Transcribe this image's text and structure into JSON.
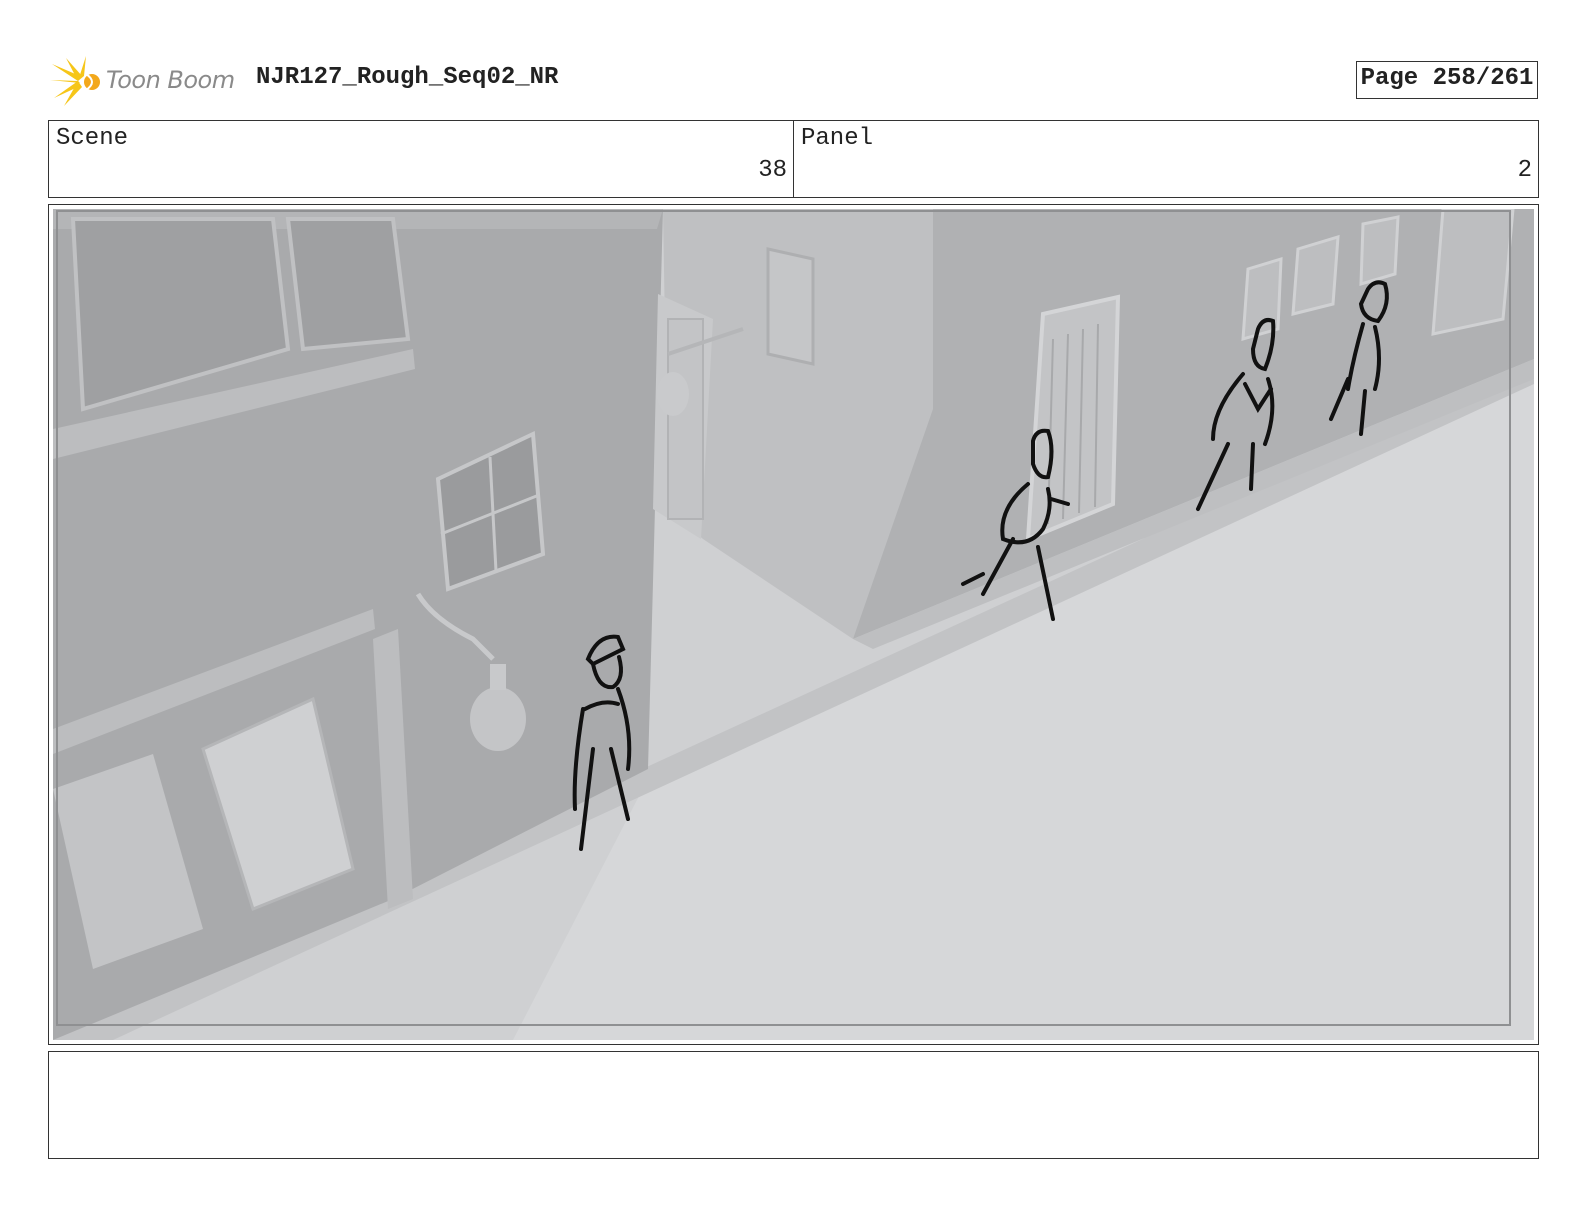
{
  "header": {
    "logo_text": "Toon Boom",
    "document_title": "NJR127_Rough_Seq02_NR",
    "page_label": "Page 258/261"
  },
  "info": {
    "scene_label": "Scene",
    "scene_value": "38",
    "panel_label": "Panel",
    "panel_value": "2"
  },
  "panel_image": {
    "icon": "storyboard-sketch-street-scene"
  },
  "notes": {
    "text": ""
  }
}
